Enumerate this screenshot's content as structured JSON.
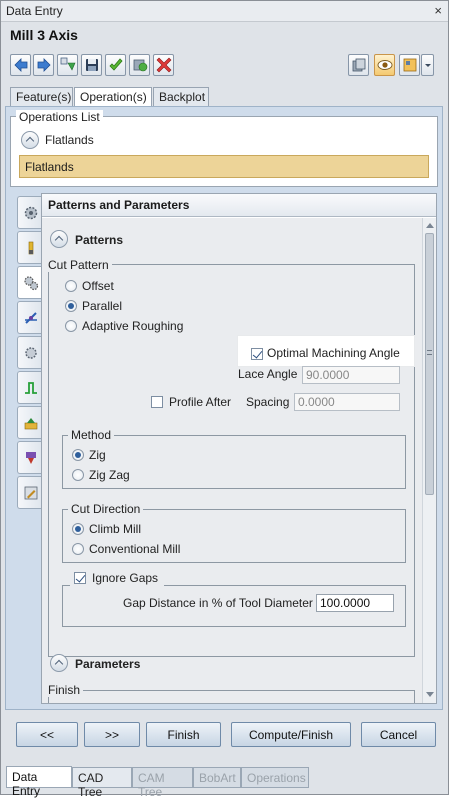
{
  "window": {
    "title": "Data Entry",
    "close_glyph": "×",
    "heading": "Mill 3 Axis"
  },
  "toolbar": {
    "left_icons": [
      "arrow-left-icon",
      "arrow-right-icon",
      "regenerate-icon",
      "save-icon",
      "check-icon",
      "preview-icon",
      "delete-icon"
    ],
    "right_icons": [
      "library-icon",
      "eye-icon",
      "settings-icon",
      "dropdown-arrow-icon"
    ]
  },
  "tabs": [
    {
      "label": "Feature(s)"
    },
    {
      "label": "Operation(s)"
    },
    {
      "label": "Backplot"
    }
  ],
  "active_tab": "Operation(s)",
  "operations": {
    "legend": "Operations List",
    "group_label": "Flatlands",
    "selected_item": "Flatlands"
  },
  "left_tabs": [
    "gear-icon",
    "tool-icon",
    "gears-icon",
    "axis-icon",
    "gear-small-icon",
    "path-icon",
    "stock-icon",
    "feature-icon",
    "edit-icon"
  ],
  "panel": {
    "title": "Patterns and Parameters",
    "patterns_header": "Patterns",
    "cut_pattern": {
      "legend": "Cut Pattern",
      "options": [
        "Offset",
        "Parallel",
        "Adaptive Roughing"
      ],
      "selected": "Parallel",
      "optimal_angle": {
        "label": "Optimal Machining Angle",
        "checked": true
      },
      "lace_angle": {
        "label": "Lace Angle",
        "value": "90.0000"
      },
      "profile_after": {
        "label": "Profile After",
        "checked": false
      },
      "spacing": {
        "label": "Spacing",
        "value": "0.0000"
      }
    },
    "method": {
      "legend": "Method",
      "options": [
        "Zig",
        "Zig Zag"
      ],
      "selected": "Zig"
    },
    "cut_direction": {
      "legend": "Cut Direction",
      "options": [
        "Climb Mill",
        "Conventional Mill"
      ],
      "selected": "Climb Mill"
    },
    "ignore_gaps": {
      "label": "Ignore Gaps",
      "checked": true,
      "gap_label": "Gap Distance in % of Tool Diameter",
      "gap_value": "100.0000"
    },
    "parameters_header": "Parameters",
    "finish_legend": "Finish"
  },
  "buttons": {
    "prev": "<<",
    "next": ">>",
    "finish": "Finish",
    "compute": "Compute/Finish",
    "cancel": "Cancel"
  },
  "bottom_tabs": [
    {
      "label": "Data Entry",
      "state": "active"
    },
    {
      "label": "CAD Tree",
      "state": "normal"
    },
    {
      "label": "CAM Tree",
      "state": "disabled"
    },
    {
      "label": "BobArt",
      "state": "disabled"
    },
    {
      "label": "Operations",
      "state": "disabled"
    }
  ]
}
